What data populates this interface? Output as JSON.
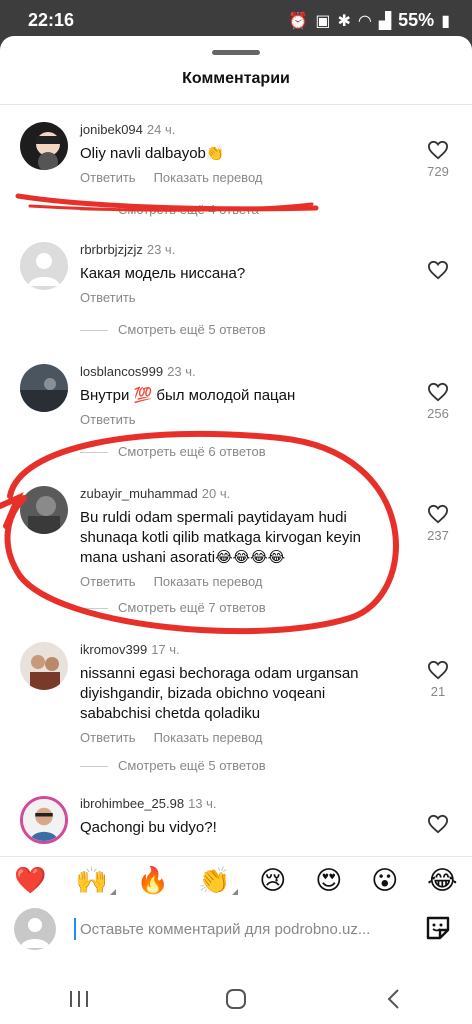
{
  "status": {
    "time": "22:16",
    "battery": "55%"
  },
  "sheet": {
    "title": "Комментарии"
  },
  "comments": [
    {
      "user": "jonibek094",
      "time": "24 ч.",
      "text": "Oliy navli dalbayob👏",
      "reply": "Ответить",
      "translate": "Показать перевод",
      "likes": "729",
      "more": "Смотреть ещё 4 ответа"
    },
    {
      "user": "rbrbrbjzjzjz",
      "time": "23 ч.",
      "text": "Какая модель ниссана?",
      "reply": "Ответить",
      "likes": "",
      "more": "Смотреть ещё 5 ответов"
    },
    {
      "user": "losblancos999",
      "time": "23 ч.",
      "text": "Внутри 💯 был молодой пацан",
      "reply": "Ответить",
      "likes": "256",
      "more": "Смотреть ещё 6 ответов"
    },
    {
      "user": "zubayir_muhammad",
      "time": "20 ч.",
      "text": "Bu ruldi odam spermali paytidayam hudi shunaqa kotli qilib matkaga kirvogan keyin mana ushani asorati😂😂😂😂",
      "reply": "Ответить",
      "translate": "Показать перевод",
      "likes": "237",
      "more": "Смотреть ещё 7 ответов"
    },
    {
      "user": "ikromov399",
      "time": "17 ч.",
      "text": "nissanni egasi bechoraga odam urgansan diyishgandir, bizada obichno voqeani sababchisi chetda qoladiku",
      "reply": "Ответить",
      "translate": "Показать перевод",
      "likes": "21",
      "more": "Смотреть ещё 5 ответов"
    },
    {
      "user": "ibrohimbee_25.98",
      "time": "13 ч.",
      "text": "Qachongi bu vidyo?!",
      "likes": ""
    }
  ],
  "emojis": [
    "❤️",
    "🙌",
    "🔥",
    "👏",
    "😢",
    "😍",
    "😮",
    "😂"
  ],
  "input": {
    "placeholder": "Оставьте комментарий для podrobno.uz..."
  },
  "icons": {
    "status": [
      "alarm-icon",
      "lock-icon",
      "bluetooth-icon",
      "wifi-icon",
      "signal-icon",
      "battery-icon"
    ],
    "like": "heart-outline-icon",
    "sticker": "sticker-icon",
    "nav": [
      "recents-icon",
      "home-icon",
      "back-icon"
    ]
  },
  "colors": {
    "annotation": "#e8302a",
    "accent": "#1a8cff",
    "secondary_text": "#888888"
  }
}
